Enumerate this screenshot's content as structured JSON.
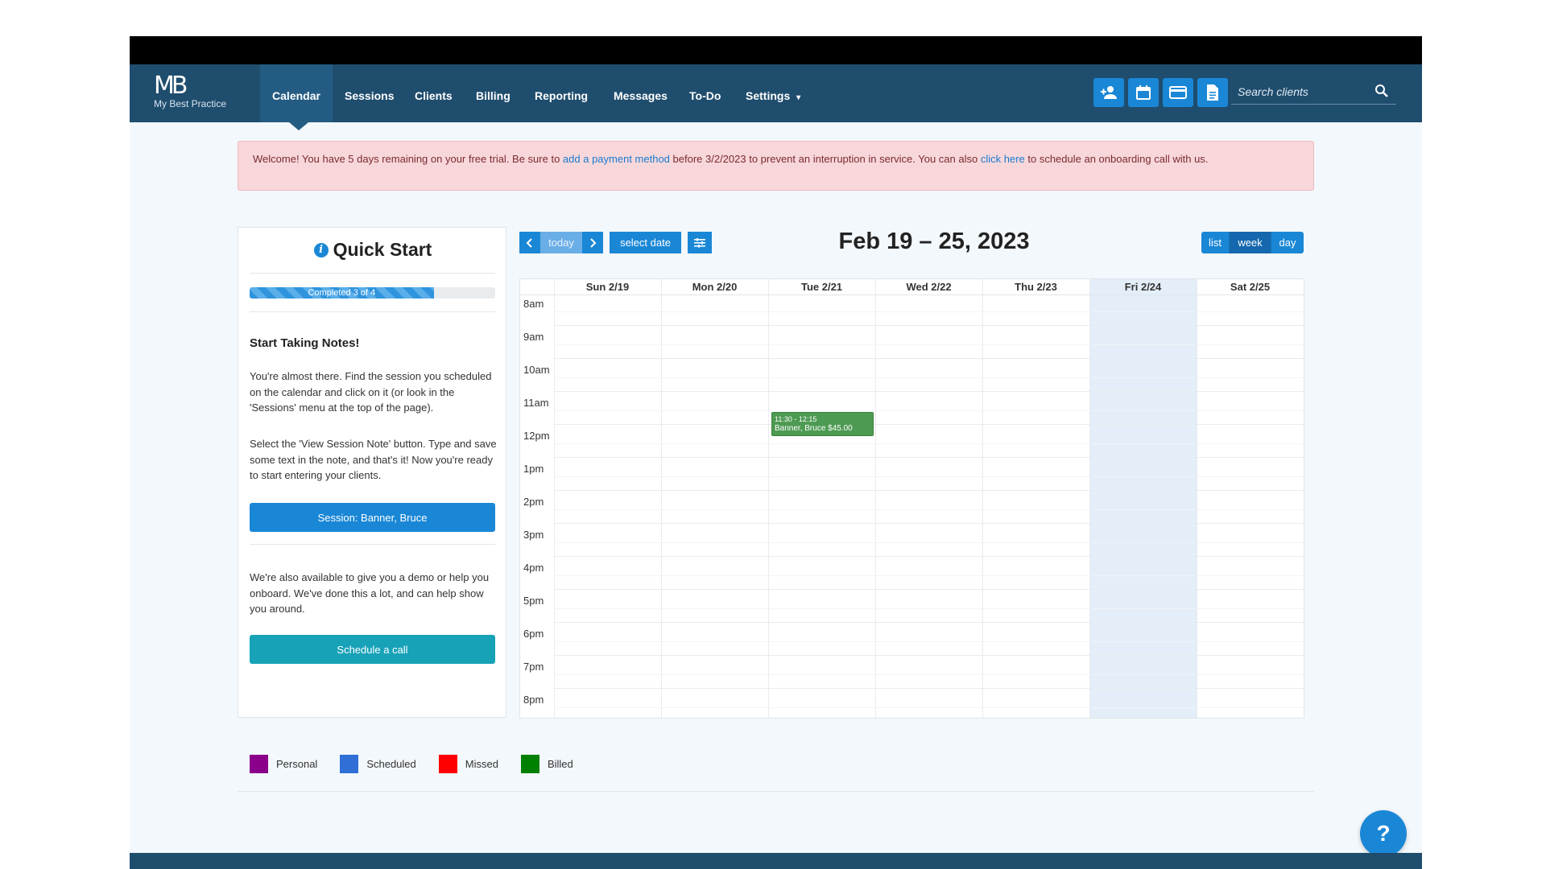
{
  "app": {
    "logo_mark": "MB",
    "logo_name": "My Best Practice"
  },
  "nav": {
    "items": [
      "Calendar",
      "Sessions",
      "Clients",
      "Billing",
      "Reporting",
      "Messages",
      "To-Do",
      "Settings"
    ],
    "active": "Calendar",
    "settings_caret": "▾"
  },
  "toolbar": {
    "icons": [
      "add-client-icon",
      "calendar-icon",
      "credit-card-icon",
      "document-icon"
    ],
    "search_placeholder": "Search clients"
  },
  "alert": {
    "text_1": "Welcome! You have 5 days remaining on your free trial. Be sure to ",
    "link_1": "add a payment method",
    "text_2": " before 3/2/2023 to prevent an interruption in service. You can also ",
    "link_2": "click here",
    "text_3": " to schedule an onboarding call with us."
  },
  "quickstart": {
    "title": "Quick Start",
    "progress_label": "Completed 3 of 4",
    "progress_fraction": 0.75,
    "heading": "Start Taking Notes!",
    "para_1": "You're almost there. Find the session you scheduled on the calendar and click on it (or look in the 'Sessions' menu at the top of the page).",
    "para_2": "Select the 'View Session Note' button. Type and save some text in the note, and that's it! Now you're ready to start entering your clients.",
    "session_button": "Session: Banner, Bruce",
    "para_3": "We're also available to give you a demo or help you onboard. We've done this a lot, and can help show you around.",
    "schedule_button": "Schedule a call"
  },
  "calendar": {
    "today_label": "today",
    "select_date_label": "select date",
    "title": "Feb 19 – 25, 2023",
    "views": [
      "list",
      "week",
      "day"
    ],
    "active_view": "week",
    "days": [
      "Sun 2/19",
      "Mon 2/20",
      "Tue 2/21",
      "Wed 2/22",
      "Thu 2/23",
      "Fri 2/24",
      "Sat 2/25"
    ],
    "today_index": 5,
    "hours": [
      "8am",
      "9am",
      "10am",
      "11am",
      "12pm",
      "1pm",
      "2pm",
      "3pm",
      "4pm",
      "5pm",
      "6pm",
      "7pm",
      "8pm"
    ],
    "event": {
      "time": "11:30 - 12:15",
      "title": "Banner, Bruce $45.00",
      "color": "#4d9a52"
    }
  },
  "legend": [
    {
      "label": "Personal",
      "color": "#8b008b"
    },
    {
      "label": "Scheduled",
      "color": "#2f6fd6"
    },
    {
      "label": "Missed",
      "color": "#ff0000"
    },
    {
      "label": "Billed",
      "color": "#008000"
    }
  ],
  "help": {
    "label": "?"
  },
  "colors": {
    "navbar": "#1f4d6e",
    "accent": "#1a87d6",
    "teal": "#17a2b8"
  }
}
